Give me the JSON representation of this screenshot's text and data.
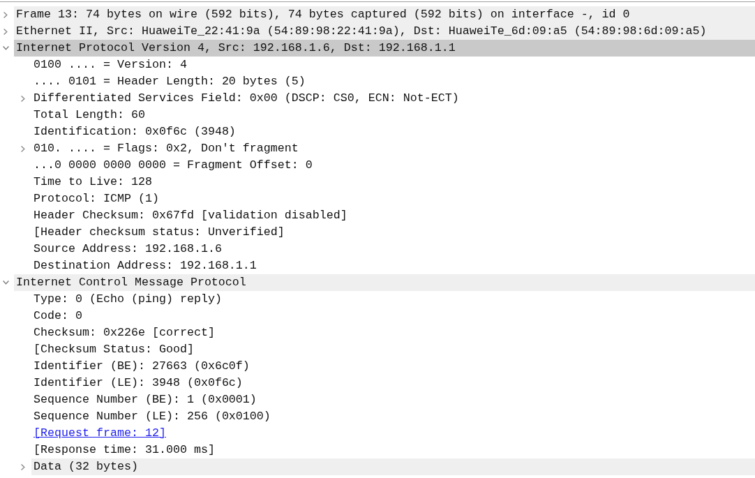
{
  "tree": [
    {
      "kind": "protocol",
      "text": "Frame 13: 74 bytes on wire (592 bits), 74 bytes captured (592 bits) on interface -, id 0",
      "expanded": false,
      "selected": false
    },
    {
      "kind": "protocol",
      "text": "Ethernet II, Src: HuaweiTe_22:41:9a (54:89:98:22:41:9a), Dst: HuaweiTe_6d:09:a5 (54:89:98:6d:09:a5)",
      "expanded": false,
      "selected": false
    },
    {
      "kind": "protocol",
      "text": "Internet Protocol Version 4, Src: 192.168.1.6, Dst: 192.168.1.1",
      "expanded": true,
      "selected": true,
      "children": [
        {
          "kind": "field",
          "text": "0100 .... = Version: 4",
          "selected": false
        },
        {
          "kind": "field",
          "text": ".... 0101 = Header Length: 20 bytes (5)",
          "selected": false
        },
        {
          "kind": "subtree",
          "text": "Differentiated Services Field: 0x00 (DSCP: CS0, ECN: Not-ECT)",
          "expanded": false,
          "selected": false
        },
        {
          "kind": "field",
          "text": "Total Length: 60",
          "selected": false
        },
        {
          "kind": "field",
          "text": "Identification: 0x0f6c (3948)",
          "selected": false
        },
        {
          "kind": "subtree",
          "text": "010. .... = Flags: 0x2, Don't fragment",
          "expanded": false,
          "selected": false
        },
        {
          "kind": "field",
          "text": "...0 0000 0000 0000 = Fragment Offset: 0",
          "selected": false
        },
        {
          "kind": "field",
          "text": "Time to Live: 128",
          "selected": false
        },
        {
          "kind": "field",
          "text": "Protocol: ICMP (1)",
          "selected": false
        },
        {
          "kind": "field",
          "text": "Header Checksum: 0x67fd [validation disabled]",
          "selected": false
        },
        {
          "kind": "field",
          "text": "[Header checksum status: Unverified]",
          "selected": false
        },
        {
          "kind": "field",
          "text": "Source Address: 192.168.1.6",
          "selected": false
        },
        {
          "kind": "field",
          "text": "Destination Address: 192.168.1.1",
          "selected": false
        }
      ]
    },
    {
      "kind": "protocol",
      "text": "Internet Control Message Protocol",
      "expanded": true,
      "selected": false,
      "children": [
        {
          "kind": "field",
          "text": "Type: 0 (Echo (ping) reply)",
          "selected": false
        },
        {
          "kind": "field",
          "text": "Code: 0",
          "selected": false
        },
        {
          "kind": "field",
          "text": "Checksum: 0x226e [correct]",
          "selected": false
        },
        {
          "kind": "field",
          "text": "[Checksum Status: Good]",
          "selected": false
        },
        {
          "kind": "field",
          "text": "Identifier (BE): 27663 (0x6c0f)",
          "selected": false
        },
        {
          "kind": "field",
          "text": "Identifier (LE): 3948 (0x0f6c)",
          "selected": false
        },
        {
          "kind": "field",
          "text": "Sequence Number (BE): 1 (0x0001)",
          "selected": false
        },
        {
          "kind": "field",
          "text": "Sequence Number (LE): 256 (0x0100)",
          "selected": false
        },
        {
          "kind": "link",
          "text": "[Request frame: 12]",
          "selected": false
        },
        {
          "kind": "field",
          "text": "[Response time: 31.000 ms]",
          "selected": false
        },
        {
          "kind": "protocol",
          "text": "Data (32 bytes)",
          "expanded": false,
          "selected": false
        }
      ]
    }
  ]
}
